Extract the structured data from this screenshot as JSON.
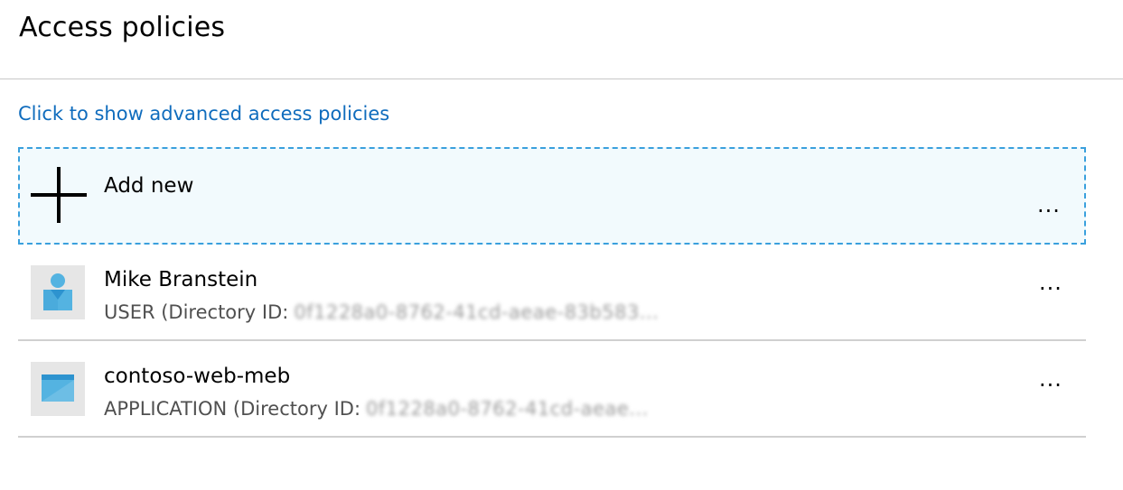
{
  "header": {
    "title": "Access policies"
  },
  "advanced_link": "Click to show advanced access policies",
  "add_new": {
    "label": "Add new",
    "more": "..."
  },
  "entries": [
    {
      "name": "Mike Branstein",
      "type_label": "USER (Directory ID:",
      "directory_id": "0f1228a0-8762-41cd-aeae-83b583...",
      "icon": "user-icon",
      "more": "..."
    },
    {
      "name": "contoso-web-meb",
      "type_label": "APPLICATION (Directory ID:",
      "directory_id": "0f1228a0-8762-41cd-aeae...",
      "icon": "application-icon",
      "more": "..."
    }
  ],
  "colors": {
    "link": "#0f6cbd",
    "add_border": "#3aa0dd",
    "add_background": "#f2fafd",
    "icon_light_blue": "#54b3e1",
    "icon_dark_blue": "#2d93cf"
  }
}
